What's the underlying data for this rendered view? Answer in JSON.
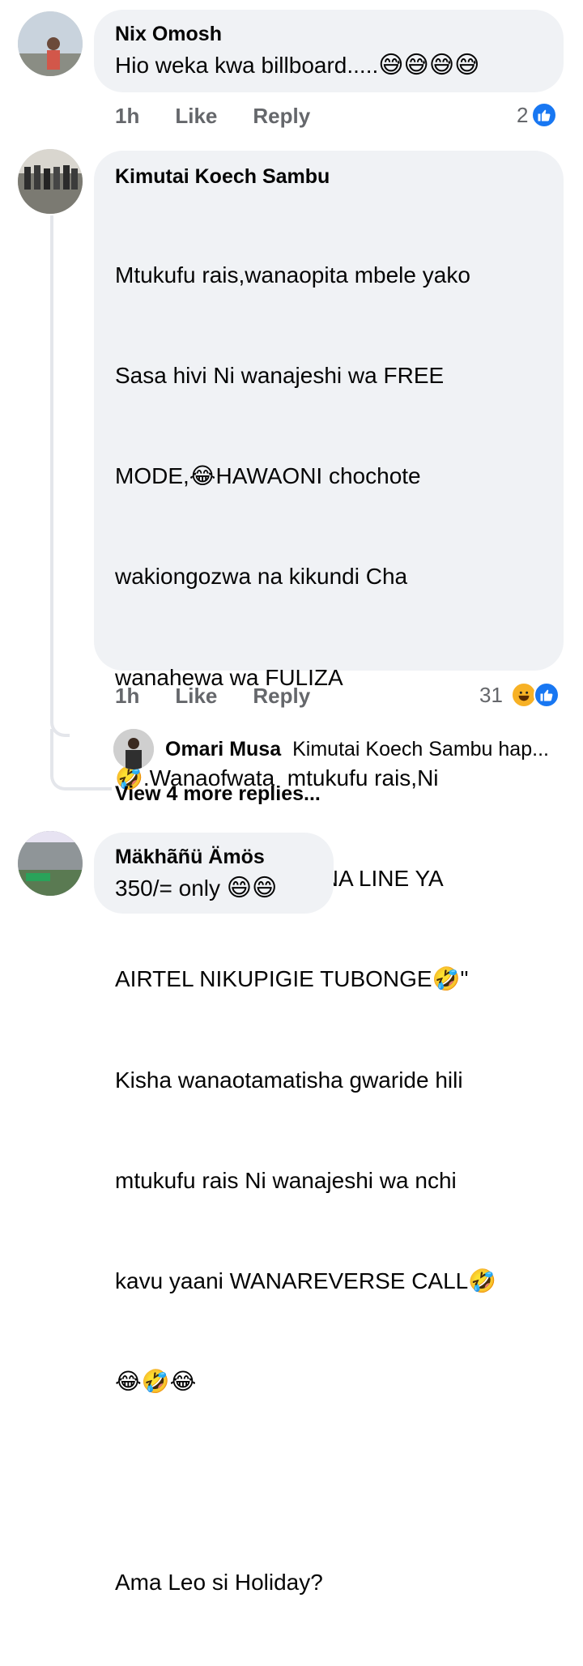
{
  "comments": [
    {
      "author": "Nix Omosh",
      "text": "Hio weka kwa billboard.....",
      "emojis": "😅😅😅😅",
      "time": "1h",
      "like_label": "Like",
      "reply_label": "Reply",
      "reaction_count": "2",
      "reaction_icons": [
        "like-icon"
      ]
    },
    {
      "author": "Kimutai Koech Sambu",
      "text_lines": [
        "Mtukufu rais,wanaopita mbele yako",
        "Sasa hivi Ni wanajeshi wa FREE",
        "MODE,😂HAWAONI chochote",
        "wakiongozwa na kikundi Cha",
        "wanahewa wa FULIZA",
        "🤣.Wanaofwata  mtukufu rais,Ni",
        "wana maji wa \"UKO NA LINE YA",
        "AIRTEL NIKUPIGIE TUBONGE🤣\"",
        "Kisha wanaotamatisha gwaride hili",
        "mtukufu rais Ni wanajeshi wa nchi",
        "kavu yaani WANAREVERSE CALL🤣",
        "😂🤣😂",
        "",
        "Ama Leo si Holiday?"
      ],
      "time": "1h",
      "like_label": "Like",
      "reply_label": "Reply",
      "reaction_count": "31",
      "reaction_icons": [
        "haha-icon",
        "like-icon"
      ],
      "reply_preview": {
        "author": "Omari Musa",
        "text": "Kimutai Koech Sambu hap..."
      },
      "view_more_label": "View 4 more replies..."
    },
    {
      "author": "Mäkhãñü Ämös",
      "text": "350/= only ",
      "emojis": "😄😄"
    }
  ],
  "colors": {
    "bubble": "#f0f2f5",
    "secondary_text": "#65676b",
    "like_blue": "#1877f2",
    "haha_yellow": "#f7b125"
  }
}
